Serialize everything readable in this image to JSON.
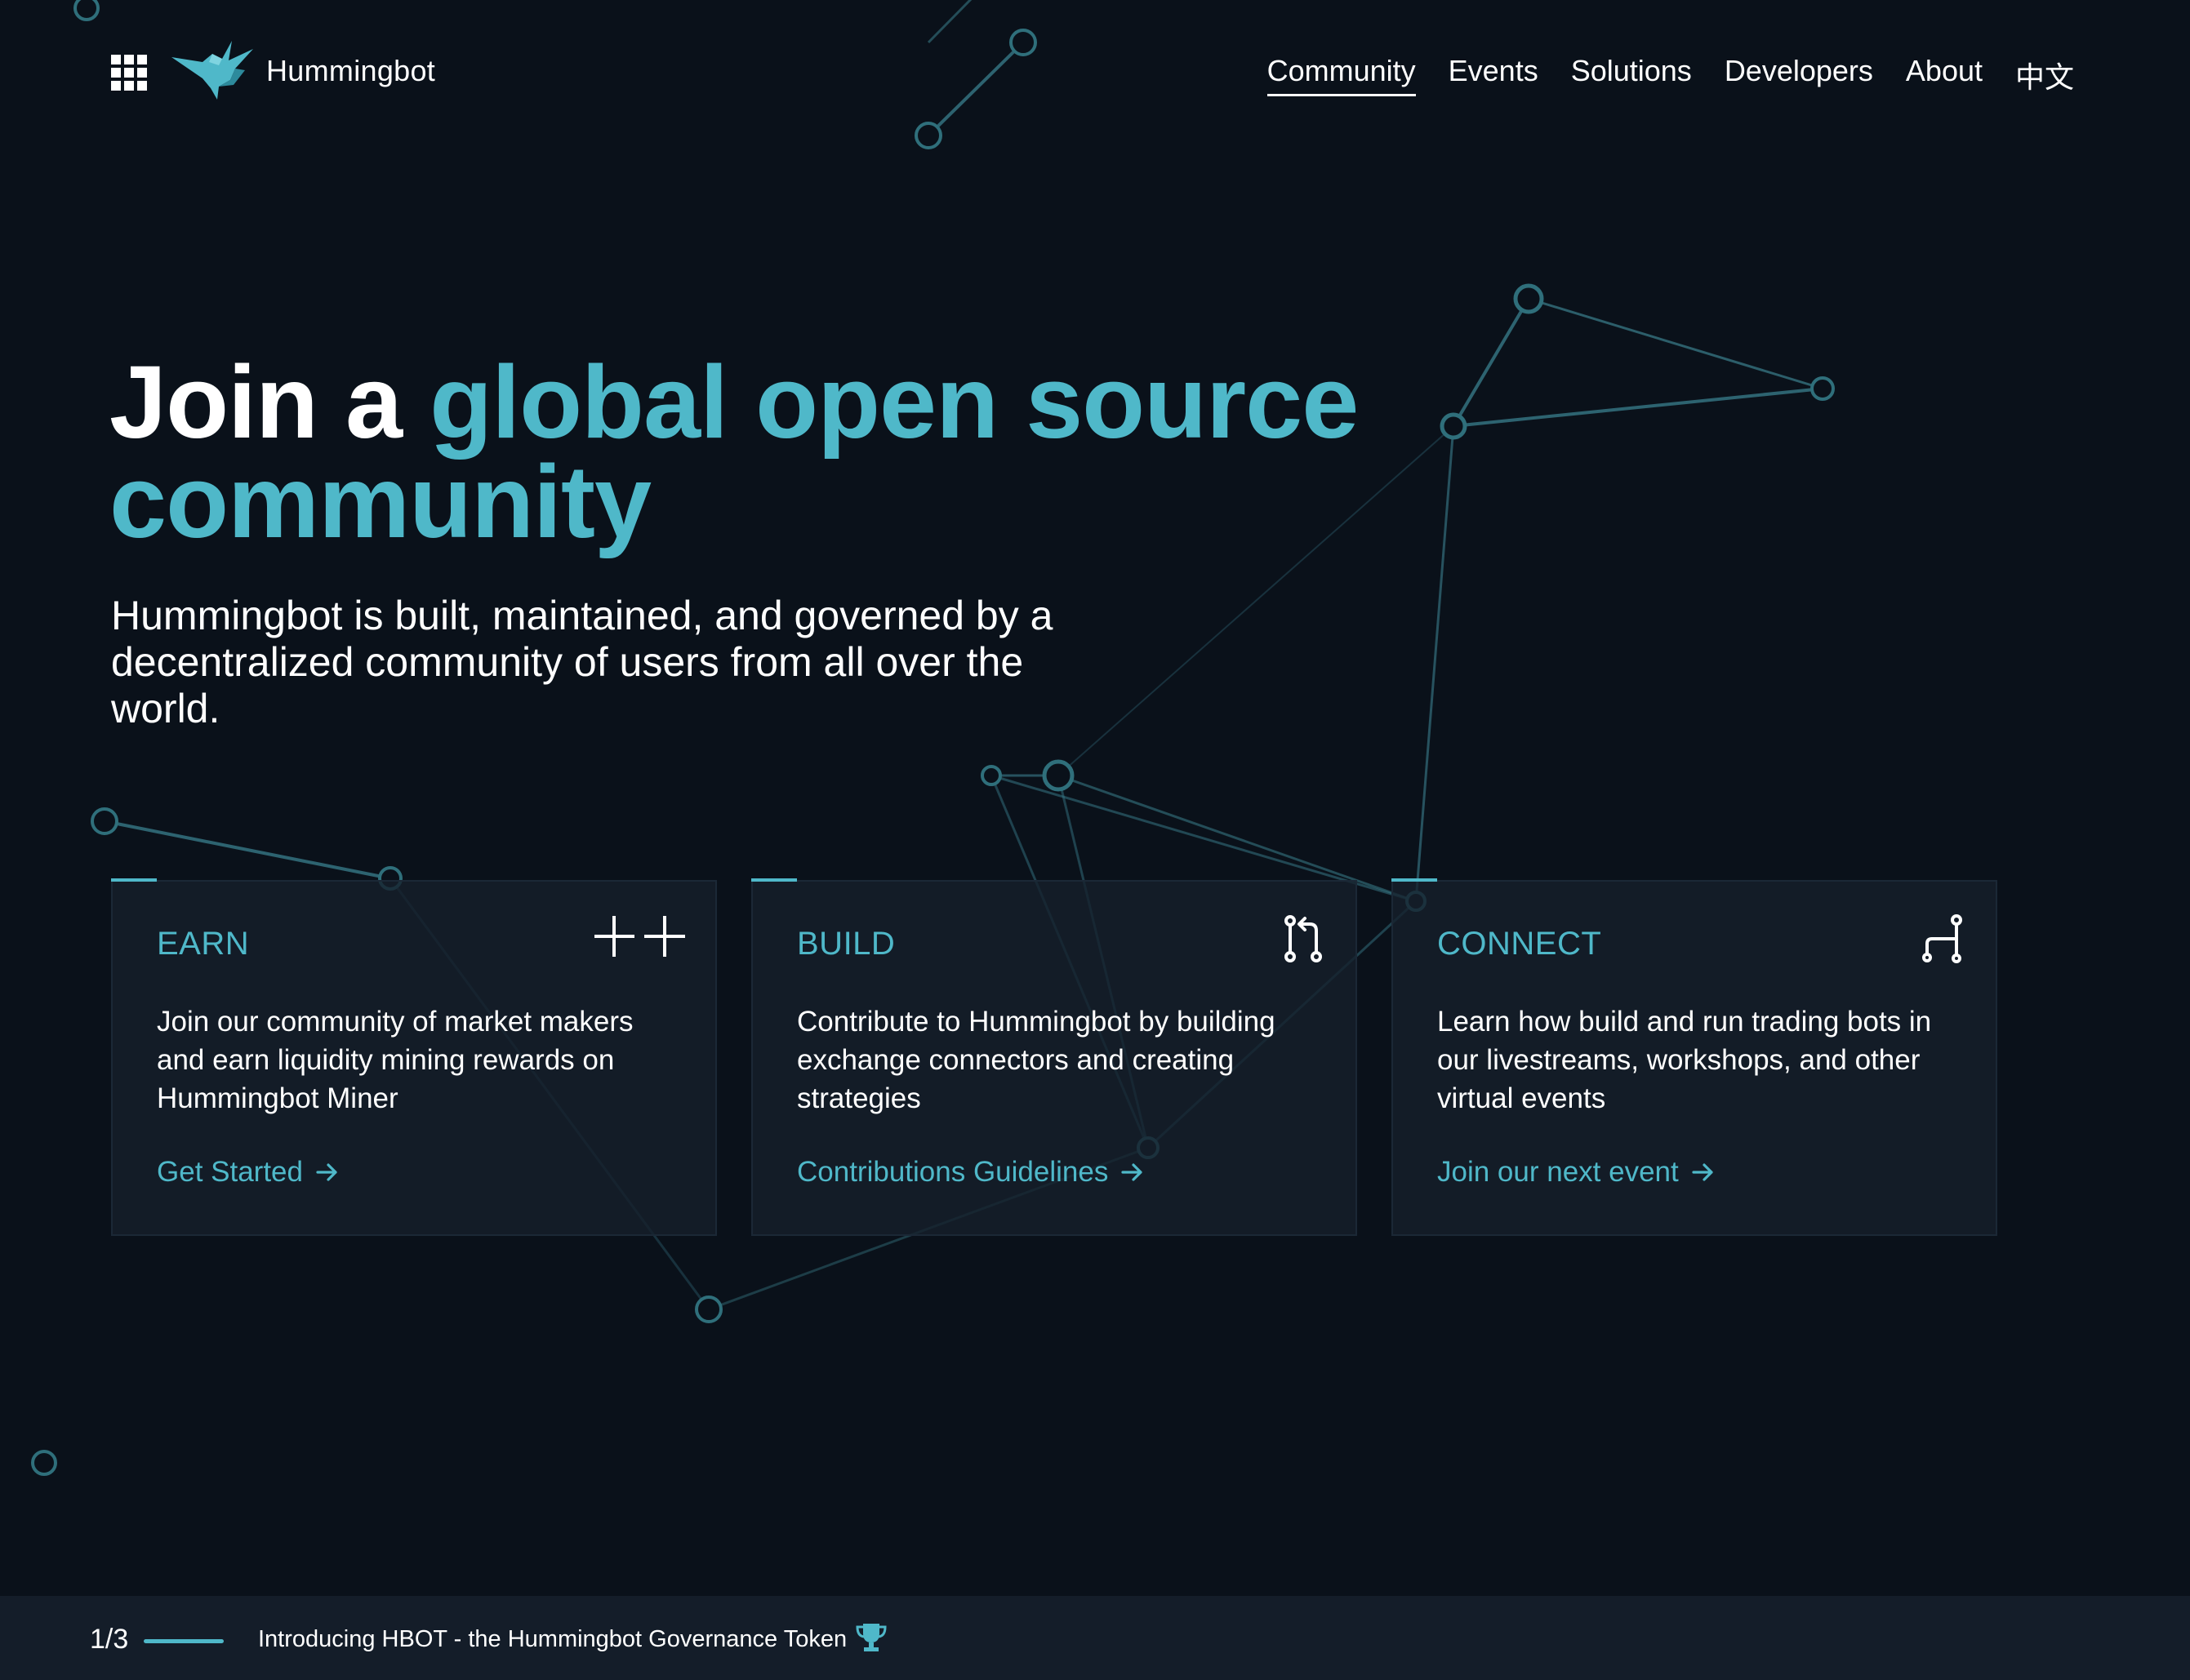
{
  "header": {
    "brand": "Hummingbot",
    "nav": {
      "community": "Community",
      "events": "Events",
      "solutions": "Solutions",
      "developers": "Developers",
      "about": "About",
      "language": "中文"
    }
  },
  "hero": {
    "title_lead": "Join a ",
    "title_accent": "global open source community",
    "subtitle": "Hummingbot is built, maintained, and governed by a decentralized community of users from all over the world."
  },
  "cards": [
    {
      "title": "EARN",
      "icon": "plus-plus-icon",
      "text": "Join our community of market makers and earn liquidity mining rewards on Hummingbot Miner",
      "link": "Get Started"
    },
    {
      "title": "BUILD",
      "icon": "pull-request-icon",
      "text": "Contribute to Hummingbot by building exchange connectors and creating strategies",
      "link": "Contributions Guidelines"
    },
    {
      "title": "CONNECT",
      "icon": "connect-node-icon",
      "text": "Learn how build and run trading bots in our livestreams, workshops, and other virtual events",
      "link": "Join our next event"
    }
  ],
  "ticker": {
    "counter": "1/3",
    "headline": "Introducing HBOT - the Hummingbot Governance Token",
    "icon": "trophy-icon"
  },
  "colors": {
    "background": "#0a111a",
    "accent": "#4fb8c9",
    "card": "#16202c",
    "ticker": "#141d29"
  }
}
